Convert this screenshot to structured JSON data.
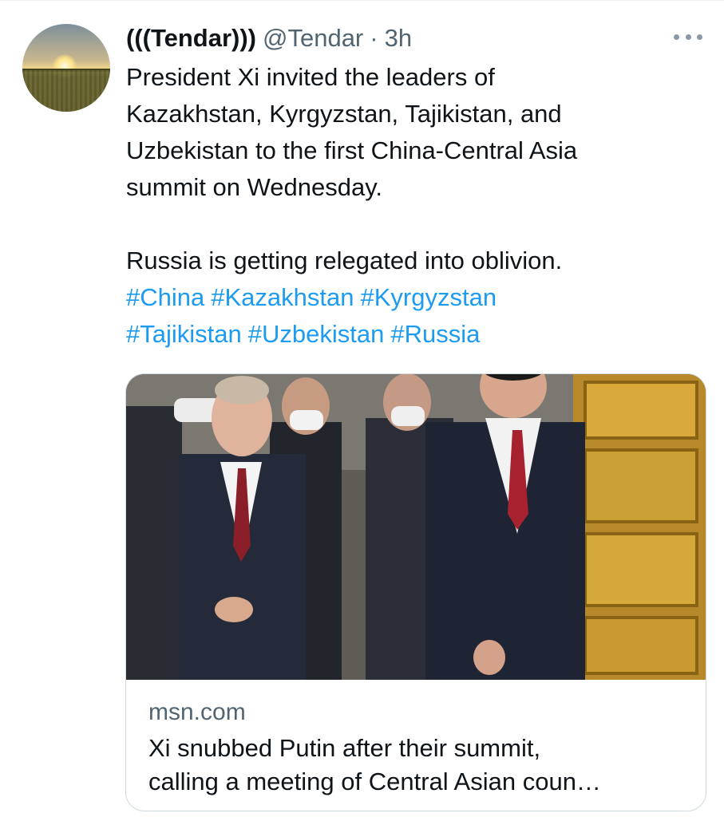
{
  "tweet": {
    "display_name": "(((Tendar)))",
    "handle": "@Tendar",
    "separator": "·",
    "time": "3h",
    "text_lines": [
      "President Xi invited the leaders of",
      "Kazakhstan, Kyrgyzstan, Tajikistan, and",
      "Uzbekistan to the first China-Central Asia",
      "summit on Wednesday."
    ],
    "text_line2": "Russia is getting relegated into oblivion.",
    "hashtags": [
      "#China",
      "#Kazakhstan",
      "#Kyrgyzstan",
      "#Tajikistan",
      "#Uzbekistan",
      "#Russia"
    ]
  },
  "card": {
    "domain": "msn.com",
    "headline_lines": [
      "Xi snubbed Putin after their summit,",
      "calling a meeting of Central Asian coun…"
    ]
  },
  "icons": {
    "more": "more-horizontal-icon",
    "avatar": "sunset-field-avatar"
  },
  "colors": {
    "text": "#0f1419",
    "secondary": "#536471",
    "link": "#1d9bf0",
    "border": "#cfd9de"
  }
}
